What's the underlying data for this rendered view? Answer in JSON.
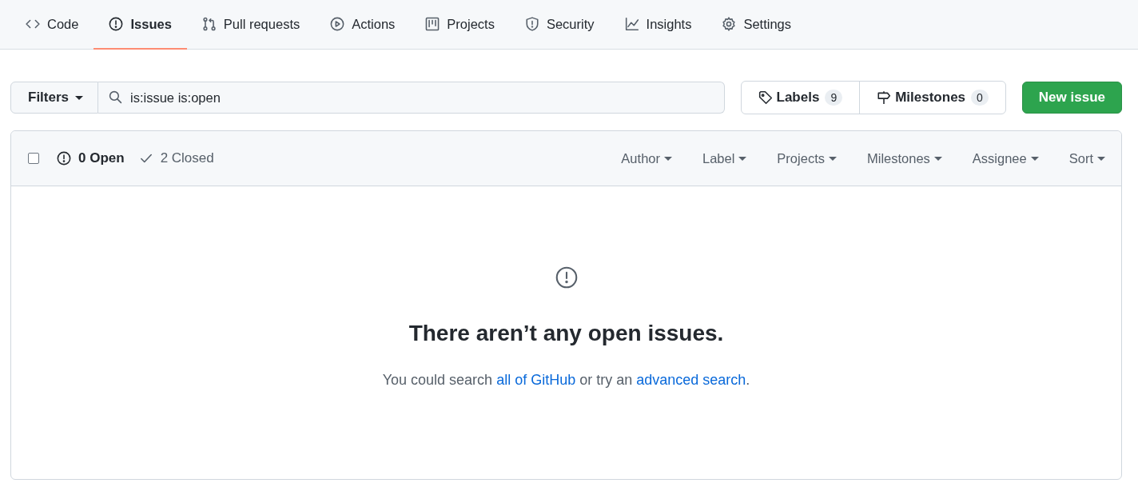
{
  "tabs": [
    {
      "label": "Code",
      "kind": "code",
      "selected": false
    },
    {
      "label": "Issues",
      "kind": "issue",
      "selected": true
    },
    {
      "label": "Pull requests",
      "kind": "pull",
      "selected": false
    },
    {
      "label": "Actions",
      "kind": "play",
      "selected": false
    },
    {
      "label": "Projects",
      "kind": "project",
      "selected": false
    },
    {
      "label": "Security",
      "kind": "shield",
      "selected": false
    },
    {
      "label": "Insights",
      "kind": "graph",
      "selected": false
    },
    {
      "label": "Settings",
      "kind": "gear",
      "selected": false
    }
  ],
  "filters": {
    "button": "Filters",
    "search_value": "is:issue is:open"
  },
  "labels": {
    "label": "Labels",
    "count": "9"
  },
  "milestones": {
    "label": "Milestones",
    "count": "0"
  },
  "new_issue": "New issue",
  "list_header": {
    "select_all_checked": false,
    "states": [
      {
        "label": "0 Open",
        "kind": "open",
        "selected": true
      },
      {
        "label": "2 Closed",
        "kind": "closed",
        "selected": false
      }
    ],
    "menus": [
      "Author",
      "Label",
      "Projects",
      "Milestones",
      "Assignee",
      "Sort"
    ]
  },
  "empty_state": {
    "title": "There aren’t any open issues.",
    "before": "You could search ",
    "link_1": "all of GitHub",
    "middle": " or try an ",
    "link_2": "advanced search",
    "after": "."
  }
}
